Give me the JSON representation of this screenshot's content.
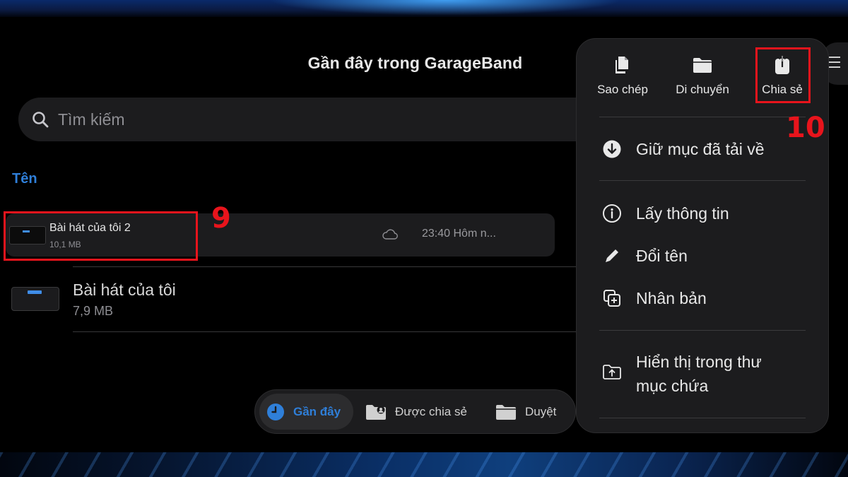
{
  "page_title": "Gần đây trong GarageBand",
  "search": {
    "placeholder": "Tìm kiếm"
  },
  "column_header": "Tên",
  "files": [
    {
      "name": "Bài hát của tôi 2",
      "size": "10,1 MB",
      "time": "23:40 Hôm n..."
    },
    {
      "name": "Bài hát của tôi",
      "size": "7,9 MB"
    }
  ],
  "tabs": [
    {
      "label": "Gần đây",
      "icon": "clock-icon",
      "active": true
    },
    {
      "label": "Được chia sẻ",
      "icon": "shared-folder-icon"
    },
    {
      "label": "Duyệt",
      "icon": "folder-icon"
    }
  ],
  "menu": {
    "quick_actions": [
      {
        "label": "Sao chép",
        "icon": "copy-icon"
      },
      {
        "label": "Di chuyển",
        "icon": "folder-icon"
      },
      {
        "label": "Chia sẻ",
        "icon": "share-icon"
      }
    ],
    "items": [
      {
        "label": "Giữ mục đã tải về",
        "icon": "download-circle-icon"
      },
      {
        "label": "Lấy thông tin",
        "icon": "info-icon"
      },
      {
        "label": "Đổi tên",
        "icon": "pencil-icon"
      },
      {
        "label": "Nhân bản",
        "icon": "duplicate-icon"
      },
      {
        "label_line1": "Hiển thị trong thư",
        "label_line2": "mục chứa",
        "icon": "folder-up-icon"
      }
    ]
  },
  "annotations": {
    "step_9": "9",
    "step_10": "10"
  },
  "colors": {
    "accent": "#2f7fd9",
    "annotation": "#e8141c",
    "panel": "#1c1c1e"
  }
}
